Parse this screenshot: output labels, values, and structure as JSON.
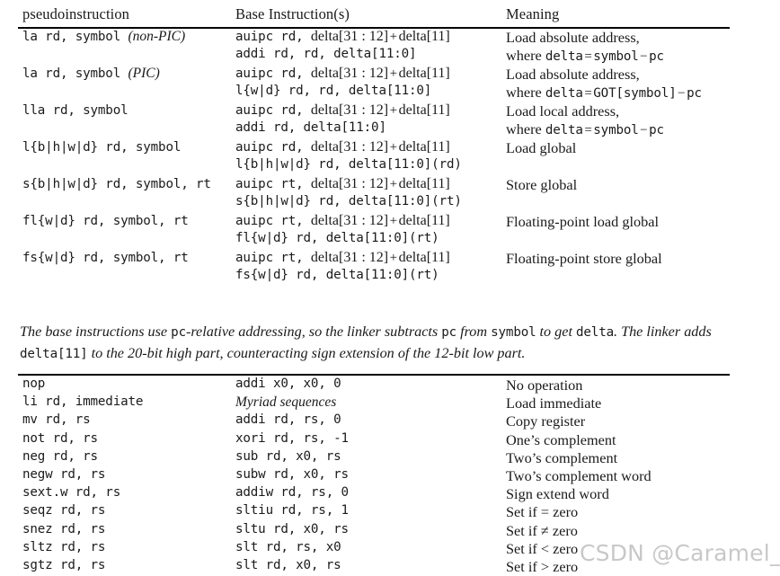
{
  "document": {
    "type": "riscv-pseudoinstruction-reference-table"
  },
  "table_top": {
    "headers": {
      "col1": "pseudoinstruction",
      "col2": "Base Instruction(s)",
      "col3": "Meaning"
    },
    "rows": [
      {
        "pseudo_mono": "la rd, symbol ",
        "pseudo_italic": "(non-PIC)",
        "base_line1_pre": "auipc rd, ",
        "base_line1_bits": "delta[31 : 12]",
        "base_line1_op": "+",
        "base_line1_post": "delta[11]",
        "base_line2": "addi rd, rd, delta[11:0]",
        "meaning_line1": "Load absolute address,",
        "meaning_line2_pre": "where ",
        "meaning_line2_mono1": "delta",
        "meaning_line2_eq": "=",
        "meaning_line2_mono2": "symbol",
        "meaning_line2_minus": "−",
        "meaning_line2_mono3": "pc"
      },
      {
        "pseudo_mono": "la rd, symbol ",
        "pseudo_italic": "(PIC)",
        "base_line1_pre": "auipc rd, ",
        "base_line1_bits": "delta[31 : 12]",
        "base_line1_op": "+",
        "base_line1_post": "delta[11]",
        "base_line2": "l{w|d} rd, rd, delta[11:0]",
        "meaning_line1": "Load absolute address,",
        "meaning_line2_pre": "where ",
        "meaning_line2_mono1": "delta",
        "meaning_line2_eq": "=",
        "meaning_line2_mono2": "GOT[symbol]",
        "meaning_line2_minus": "−",
        "meaning_line2_mono3": "pc"
      },
      {
        "pseudo_mono": "lla rd, symbol",
        "pseudo_italic": "",
        "base_line1_pre": "auipc rd, ",
        "base_line1_bits": "delta[31 : 12]",
        "base_line1_op": "+",
        "base_line1_post": "delta[11]",
        "base_line2": "addi rd, delta[11:0]",
        "meaning_line1": "Load local address,",
        "meaning_line2_pre": "where ",
        "meaning_line2_mono1": "delta",
        "meaning_line2_eq": "=",
        "meaning_line2_mono2": "symbol",
        "meaning_line2_minus": "−",
        "meaning_line2_mono3": "pc"
      },
      {
        "pseudo_mono": "l{b|h|w|d} rd, symbol",
        "pseudo_italic": "",
        "base_line1_pre": "auipc rd, ",
        "base_line1_bits": "delta[31 : 12]",
        "base_line1_op": "+",
        "base_line1_post": "delta[11]",
        "base_line2": "l{b|h|w|d} rd, delta[11:0](rd)",
        "meaning_line1": "Load global",
        "meaning_line2_pre": "",
        "meaning_line2_mono1": "",
        "meaning_line2_eq": "",
        "meaning_line2_mono2": "",
        "meaning_line2_minus": "",
        "meaning_line2_mono3": ""
      },
      {
        "pseudo_mono": "s{b|h|w|d} rd, symbol, rt",
        "pseudo_italic": "",
        "base_line1_pre": "auipc rt, ",
        "base_line1_bits": "delta[31 : 12]",
        "base_line1_op": "+",
        "base_line1_post": "delta[11]",
        "base_line2": "s{b|h|w|d} rd, delta[11:0](rt)",
        "meaning_line1": "Store global",
        "meaning_line2_pre": "",
        "meaning_line2_mono1": "",
        "meaning_line2_eq": "",
        "meaning_line2_mono2": "",
        "meaning_line2_minus": "",
        "meaning_line2_mono3": ""
      },
      {
        "pseudo_mono": "fl{w|d} rd, symbol, rt",
        "pseudo_italic": "",
        "base_line1_pre": "auipc rt, ",
        "base_line1_bits": "delta[31 : 12]",
        "base_line1_op": "+",
        "base_line1_post": "delta[11]",
        "base_line2": "fl{w|d} rd, delta[11:0](rt)",
        "meaning_line1": "Floating-point load global",
        "meaning_line2_pre": "",
        "meaning_line2_mono1": "",
        "meaning_line2_eq": "",
        "meaning_line2_mono2": "",
        "meaning_line2_minus": "",
        "meaning_line2_mono3": ""
      },
      {
        "pseudo_mono": "fs{w|d} rd, symbol, rt",
        "pseudo_italic": "",
        "base_line1_pre": "auipc rt, ",
        "base_line1_bits": "delta[31 : 12]",
        "base_line1_op": "+",
        "base_line1_post": "delta[11]",
        "base_line2": "fs{w|d} rd, delta[11:0](rt)",
        "meaning_line1": "Floating-point store global",
        "meaning_line2_pre": "",
        "meaning_line2_mono1": "",
        "meaning_line2_eq": "",
        "meaning_line2_mono2": "",
        "meaning_line2_minus": "",
        "meaning_line2_mono3": ""
      }
    ]
  },
  "note": {
    "seg1": "The base instructions use ",
    "mono1": "pc",
    "seg2": "-relative addressing, so the linker subtracts ",
    "mono2": "pc",
    "seg3": " from ",
    "mono3": "symbol",
    "seg4": " to get ",
    "mono4": "delta",
    "seg5": ". The linker adds ",
    "mono5": "delta[11]",
    "seg6": " to the 20-bit high part, counteracting sign extension of the 12-bit low part."
  },
  "table_bottom": {
    "rows": [
      {
        "pseudo": "nop",
        "base": "addi x0, x0, 0",
        "base_italic": false,
        "meaning": "No operation"
      },
      {
        "pseudo": "li rd, immediate",
        "base": "Myriad sequences",
        "base_italic": true,
        "meaning": "Load immediate"
      },
      {
        "pseudo": "mv rd, rs",
        "base": "addi rd, rs, 0",
        "base_italic": false,
        "meaning": "Copy register"
      },
      {
        "pseudo": "not rd, rs",
        "base": "xori rd, rs, -1",
        "base_italic": false,
        "meaning": "One’s complement"
      },
      {
        "pseudo": "neg rd, rs",
        "base": "sub rd, x0, rs",
        "base_italic": false,
        "meaning": "Two’s complement"
      },
      {
        "pseudo": "negw rd, rs",
        "base": "subw rd, x0, rs",
        "base_italic": false,
        "meaning": "Two’s complement word"
      },
      {
        "pseudo": "sext.w rd, rs",
        "base": "addiw rd, rs, 0",
        "base_italic": false,
        "meaning": "Sign extend word"
      },
      {
        "pseudo": "seqz rd, rs",
        "base": "sltiu rd, rs, 1",
        "base_italic": false,
        "meaning": "Set if = zero"
      },
      {
        "pseudo": "snez rd, rs",
        "base": "sltu rd, x0, rs",
        "base_italic": false,
        "meaning": "Set if ≠ zero"
      },
      {
        "pseudo": "sltz rd, rs",
        "base": "slt rd, rs, x0",
        "base_italic": false,
        "meaning": "Set if < zero"
      },
      {
        "pseudo": "sgtz rd, rs",
        "base": "slt rd, x0, rs",
        "base_italic": false,
        "meaning": "Set if > zero"
      }
    ]
  },
  "watermark": {
    "text": "CSDN @Caramel_biscuit",
    "color": "#c8c8c8"
  }
}
